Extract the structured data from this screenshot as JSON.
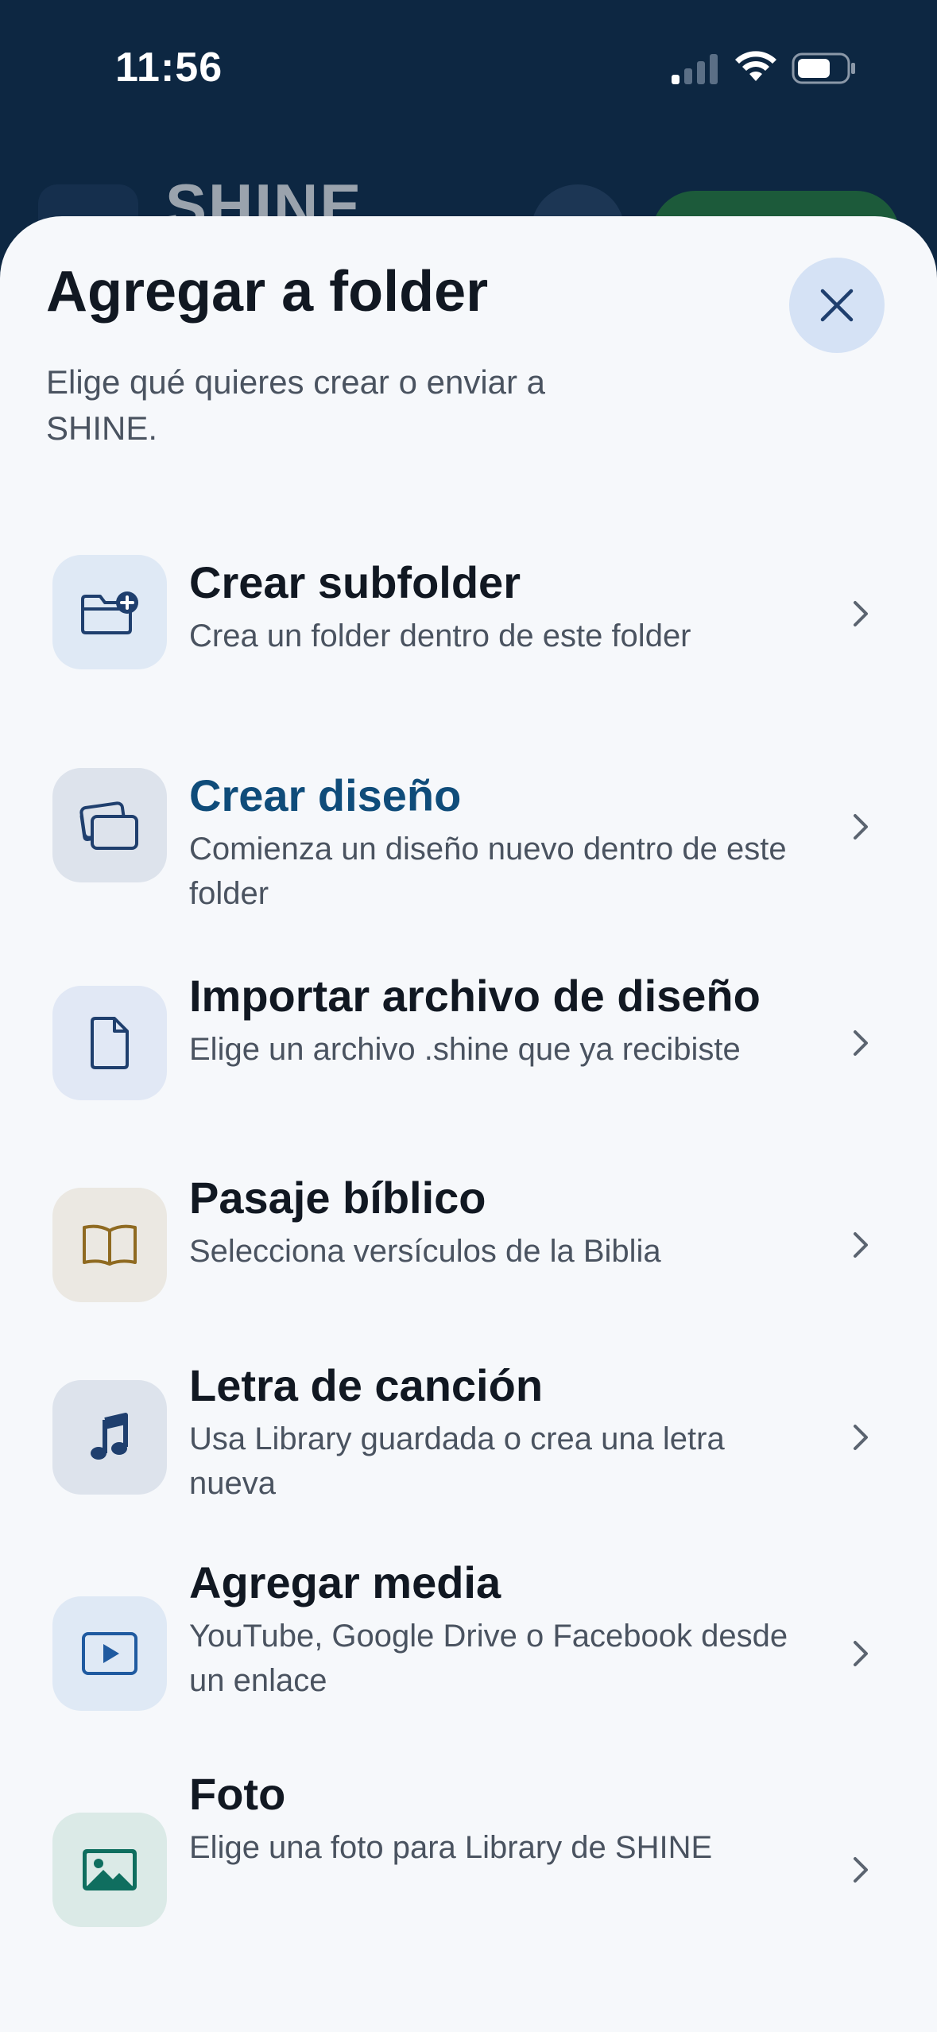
{
  "status_bar": {
    "time": "11:56"
  },
  "background_app": {
    "logo_text": "SHINE"
  },
  "sheet": {
    "title": "Agregar a folder",
    "subtitle": "Elige qué quieres crear o enviar a SHINE.",
    "close_icon": "close-icon"
  },
  "options": [
    {
      "title": "Crear subfolder",
      "description": "Crea un folder dentro de este folder",
      "icon": "folder-plus-icon",
      "highlighted": false
    },
    {
      "title": "Crear diseño",
      "description": "Comienza un diseño nuevo dentro de este folder",
      "icon": "cards-icon",
      "highlighted": true
    },
    {
      "title": "Importar archivo de diseño",
      "description": "Elige un archivo .shine que ya recibiste",
      "icon": "file-icon",
      "highlighted": false
    },
    {
      "title": "Pasaje bíblico",
      "description": "Selecciona versículos de la Biblia",
      "icon": "book-icon",
      "highlighted": false
    },
    {
      "title": "Letra de canción",
      "description": "Usa Library guardada o crea una letra nueva",
      "icon": "music-note-icon",
      "highlighted": false
    },
    {
      "title": "Agregar media",
      "description": "YouTube, Google Drive o Facebook desde un enlace",
      "icon": "play-icon",
      "highlighted": false
    },
    {
      "title": "Foto",
      "description": "Elige una foto para Library de SHINE",
      "icon": "image-icon",
      "highlighted": false
    }
  ],
  "colors": {
    "sheet_bg": "#f6f8fb",
    "highlight_title": "#0f4c7a",
    "accent_navy": "#1f3f6e"
  }
}
